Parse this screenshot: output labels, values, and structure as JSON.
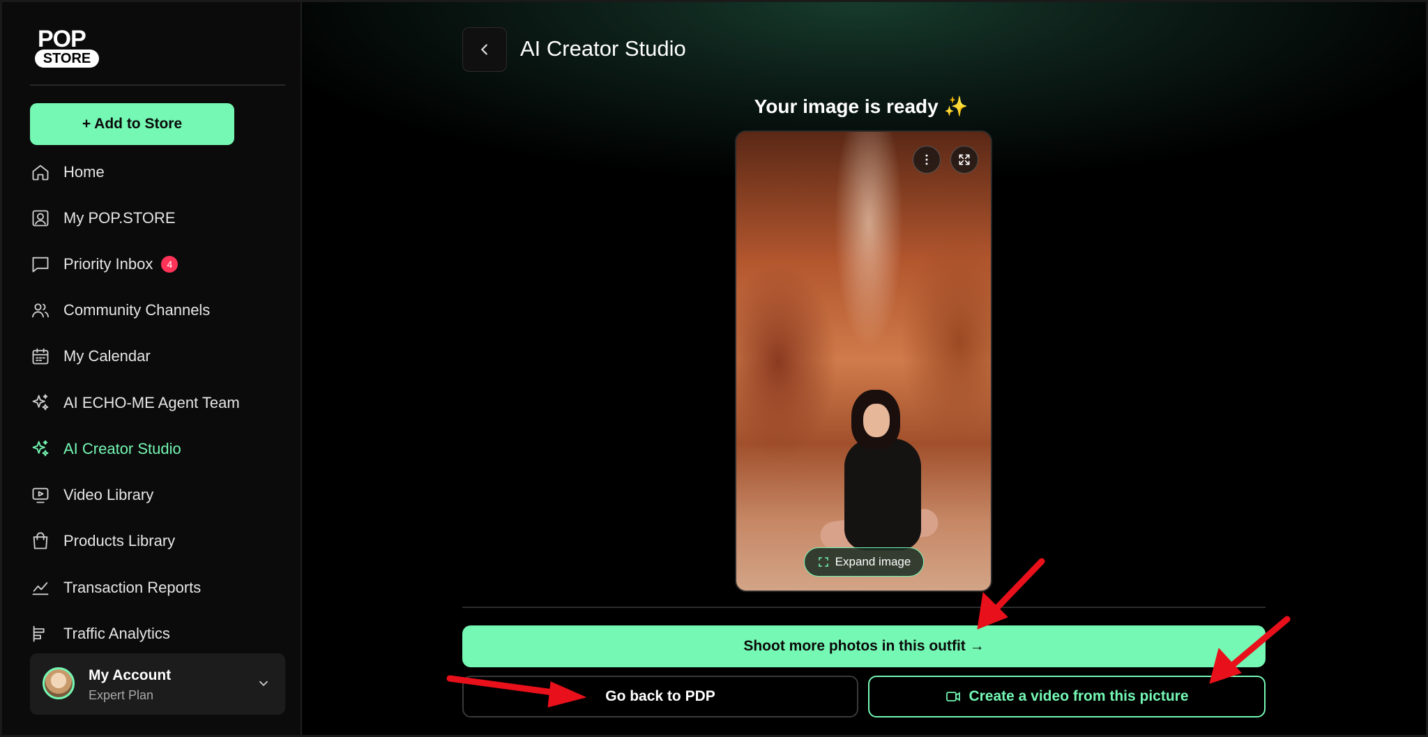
{
  "brand": {
    "logo_top": "POP",
    "logo_bottom": "STORE"
  },
  "sidebar": {
    "add_button": "+ Add to Store",
    "items": [
      {
        "label": "Home",
        "icon": "home-icon"
      },
      {
        "label": "My POP.STORE",
        "icon": "profile-icon"
      },
      {
        "label": "Priority Inbox",
        "icon": "chat-icon",
        "badge": "4"
      },
      {
        "label": "Community Channels",
        "icon": "users-icon"
      },
      {
        "label": "My Calendar",
        "icon": "calendar-icon"
      },
      {
        "label": "AI ECHO-ME Agent Team",
        "icon": "sparkles-icon"
      },
      {
        "label": "AI Creator Studio",
        "icon": "sparkles-icon",
        "active": true
      },
      {
        "label": "Video Library",
        "icon": "video-icon"
      },
      {
        "label": "Products Library",
        "icon": "bag-icon"
      },
      {
        "label": "Transaction Reports",
        "icon": "chart-line-icon"
      },
      {
        "label": "Traffic Analytics",
        "icon": "bar-chart-icon"
      }
    ],
    "account": {
      "name": "My Account",
      "plan": "Expert Plan"
    }
  },
  "main": {
    "title": "AI Creator Studio",
    "ready_heading": "Your image is ready ✨",
    "expand_label": "Expand image",
    "shoot_button": "Shoot more photos in this outfit →",
    "pdp_button": "Go back to PDP",
    "video_button": "Create a video from this picture"
  },
  "colors": {
    "accent": "#75f8b4",
    "badge": "#ff3358",
    "annotation": "#e8101a"
  }
}
